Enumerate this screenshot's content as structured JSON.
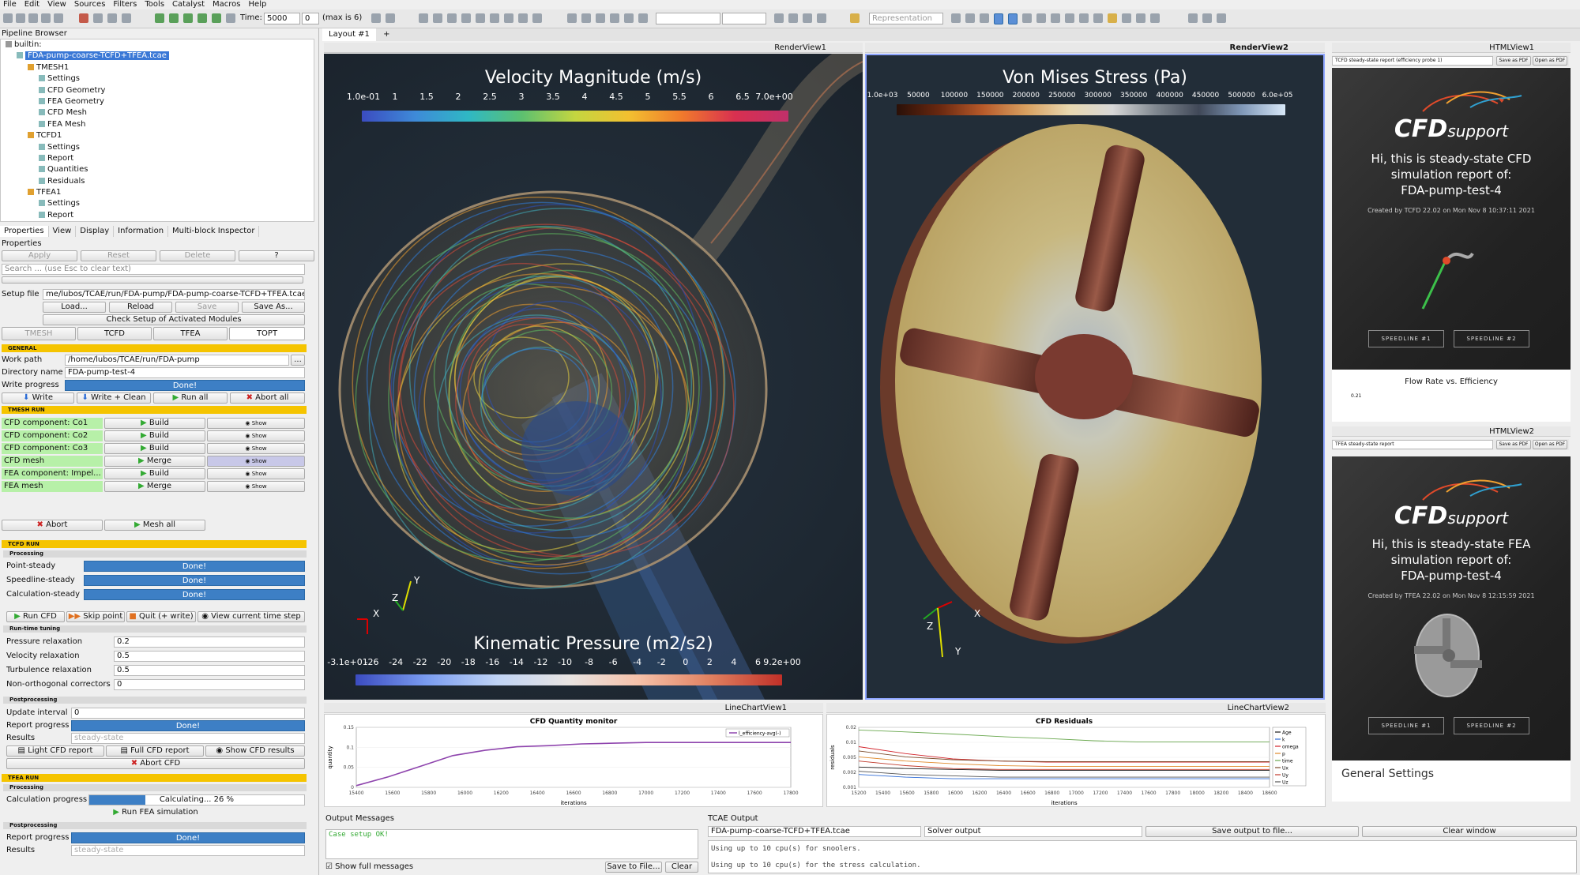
{
  "menu": [
    "File",
    "Edit",
    "View",
    "Sources",
    "Filters",
    "Tools",
    "Catalyst",
    "Macros",
    "Help"
  ],
  "toolbar": {
    "time_label": "Time:",
    "time_value": "5000",
    "step_value": "0",
    "max_label": "(max is 6)",
    "representation_placeholder": "Representation"
  },
  "pipeline": {
    "title": "Pipeline Browser",
    "items": [
      {
        "label": "builtin:",
        "depth": 0,
        "selected": false
      },
      {
        "label": "FDA-pump-coarse-TCFD+TFEA.tcae",
        "depth": 1,
        "selected": true
      },
      {
        "label": "TMESH1",
        "depth": 2,
        "selected": false
      },
      {
        "label": "Settings",
        "depth": 3,
        "selected": false
      },
      {
        "label": "CFD Geometry",
        "depth": 3,
        "selected": false
      },
      {
        "label": "FEA Geometry",
        "depth": 3,
        "selected": false
      },
      {
        "label": "CFD Mesh",
        "depth": 3,
        "selected": false
      },
      {
        "label": "FEA Mesh",
        "depth": 3,
        "selected": false
      },
      {
        "label": "TCFD1",
        "depth": 2,
        "selected": false
      },
      {
        "label": "Settings",
        "depth": 3,
        "selected": false
      },
      {
        "label": "Report",
        "depth": 3,
        "selected": false
      },
      {
        "label": "Quantities",
        "depth": 3,
        "selected": false
      },
      {
        "label": "Residuals",
        "depth": 3,
        "selected": false
      },
      {
        "label": "TFEA1",
        "depth": 2,
        "selected": false
      },
      {
        "label": "Settings",
        "depth": 3,
        "selected": false
      },
      {
        "label": "Report",
        "depth": 3,
        "selected": false
      }
    ]
  },
  "panel_tabs": [
    "Properties",
    "View",
    "Display",
    "Information",
    "Multi-block Inspector"
  ],
  "properties": {
    "title": "Properties",
    "apply": "Apply",
    "reset": "Reset",
    "delete": "Delete",
    "help": "?",
    "search_placeholder": "Search ... (use Esc to clear text)",
    "setup_file_label": "Setup file",
    "setup_file_value": "me/lubos/TCAE/run/FDA-pump/FDA-pump-coarse-TCFD+TFEA.tcae",
    "load": "Load...",
    "reload": "Reload",
    "save": "Save",
    "save_as": "Save As...",
    "check_setup": "Check Setup of Activated Modules",
    "module_tabs": [
      "TMESH",
      "TCFD",
      "TFEA",
      "TOPT"
    ],
    "general": "GENERAL",
    "work_path_label": "Work path",
    "work_path_value": "/home/lubos/TCAE/run/FDA-pump",
    "browse": "...",
    "dir_name_label": "Directory name",
    "dir_name_value": "FDA-pump-test-4",
    "write_progress_label": "Write progress",
    "write_progress_value": "Done!",
    "write": "Write",
    "write_clean": "Write + Clean",
    "run_all": "Run all",
    "abort_all": "Abort all",
    "tmesh_run": "TMESH RUN",
    "tmesh_rows": [
      {
        "label": "CFD component: Co1",
        "action": "Build",
        "show": "Show"
      },
      {
        "label": "CFD component: Co2",
        "action": "Build",
        "show": "Show"
      },
      {
        "label": "CFD component: Co3",
        "action": "Build",
        "show": "Show"
      },
      {
        "label": "CFD mesh",
        "action": "Merge",
        "show": "Show"
      },
      {
        "label": "FEA component: Impel...",
        "action": "Build",
        "show": "Show"
      },
      {
        "label": "FEA mesh",
        "action": "Merge",
        "show": "Show"
      }
    ],
    "abort": "Abort",
    "mesh_all": "Mesh all",
    "tcfd_run": "TCFD RUN",
    "processing": "Processing",
    "steps": [
      {
        "label": "Point-steady",
        "value": "Done!"
      },
      {
        "label": "Speedline-steady",
        "value": "Done!"
      },
      {
        "label": "Calculation-steady",
        "value": "Done!"
      }
    ],
    "run_cfd": "Run CFD",
    "skip_point": "Skip point",
    "quit_write": "Quit (+ write)",
    "view_step": "View current time step",
    "runtime_tuning": "Run-time tuning",
    "tuning": [
      {
        "label": "Pressure relaxation",
        "value": "0.2"
      },
      {
        "label": "Velocity relaxation",
        "value": "0.5"
      },
      {
        "label": "Turbulence relaxation",
        "value": "0.5"
      },
      {
        "label": "Non-orthogonal correctors",
        "value": "0"
      }
    ],
    "postprocessing": "Postprocessing",
    "update_interval_label": "Update interval",
    "update_interval_value": "0",
    "report_progress_label": "Report progress",
    "report_progress_value": "Done!",
    "results_label": "Results",
    "results_value": "steady-state",
    "light_report": "Light CFD report",
    "full_report": "Full CFD report",
    "show_results": "Show CFD results",
    "abort_cfd": "Abort CFD",
    "tfea_run": "TFEA RUN",
    "calc_progress_label": "Calculation progress",
    "calc_progress_text": "Calculating... 26 %",
    "calc_progress_fraction": 0.26,
    "run_fea": "Run FEA simulation",
    "report_progress2_value": "Done!",
    "results2_value": "steady-state"
  },
  "layout": {
    "tab": "Layout #1",
    "add": "+"
  },
  "renderview1": {
    "name": "RenderView1",
    "title": "Velocity  Magnitude (m/s)",
    "ticks": [
      "1.0e-01",
      "1",
      "1.5",
      "2",
      "2.5",
      "3",
      "3.5",
      "4",
      "4.5",
      "5",
      "5.5",
      "6",
      "6.5",
      "7.0e+00"
    ],
    "title2": "Kinematic Pressure (m2/s2)",
    "ticks2": [
      "-3.1e+01",
      "-26",
      "-24",
      "-22",
      "-20",
      "-18",
      "-16",
      "-14",
      "-12",
      "-10",
      "-8",
      "-6",
      "-4",
      "-2",
      "0",
      "2",
      "4",
      "6",
      "9.2e+00"
    ],
    "axes": [
      "X",
      "Y",
      "Z"
    ]
  },
  "renderview2": {
    "name": "RenderView2",
    "title": "Von Mises Stress (Pa)",
    "ticks": [
      "1.0e+03",
      "50000",
      "100000",
      "150000",
      "200000",
      "250000",
      "300000",
      "350000",
      "400000",
      "450000",
      "500000",
      "6.0e+05"
    ],
    "axes": [
      "X",
      "Y",
      "Z"
    ]
  },
  "htmlview1": {
    "name": "HTMLView1",
    "select": "TCFD steady-state report (efficiency probe 1)",
    "save": "Save as PDF",
    "open": "Open as PDF",
    "logo_main": "CFD",
    "logo_sub": "support",
    "line1": "Hi, this is steady-state CFD",
    "line2": "simulation report of:",
    "line3": "FDA-pump-test-4",
    "created": "Created by TCFD 22.02 on Mon Nov 8 10:37:11 2021",
    "btn1": "SPEEDLINE #1",
    "btn2": "SPEEDLINE #2",
    "section": "Flow Rate vs. Efficiency",
    "axis_val": "0.21"
  },
  "htmlview2": {
    "name": "HTMLView2",
    "select": "TFEA steady-state report",
    "save": "Save as PDF",
    "open": "Open as PDF",
    "logo_main": "CFD",
    "logo_sub": "support",
    "line1": "Hi, this is steady-state FEA",
    "line2": "simulation report of:",
    "line3": "FDA-pump-test-4",
    "created": "Created by TFEA 22.02 on Mon Nov 8 12:15:59 2021",
    "btn1": "SPEEDLINE #1",
    "btn2": "SPEEDLINE #2",
    "section": "General Settings"
  },
  "linechart1": {
    "name": "LineChartView1",
    "title": "CFD Quantity monitor",
    "ylabel": "quantity",
    "xlabel": "iterations",
    "legend": "l_efficiency-avg(-)",
    "yticks": [
      "0.15",
      "0.1",
      "0.05",
      "0"
    ],
    "xticks": [
      "15400",
      "15600",
      "15800",
      "16000",
      "16200",
      "16400",
      "16600",
      "16800",
      "17000",
      "17200",
      "17400",
      "17600",
      "17800"
    ]
  },
  "linechart2": {
    "name": "LineChartView2",
    "title": "CFD Residuals",
    "ylabel": "residuals",
    "xlabel": "iterations",
    "legend": [
      "Age",
      "k",
      "omega",
      "p",
      "time",
      "Ux",
      "Uy",
      "Uz"
    ],
    "yticks": [
      "0.02",
      "0.01",
      "0.005",
      "0.002",
      "0.001"
    ],
    "xticks": [
      "15200",
      "15400",
      "15600",
      "15800",
      "16000",
      "16200",
      "16400",
      "16600",
      "16800",
      "17000",
      "17200",
      "17400",
      "17600",
      "17800",
      "18000",
      "18200",
      "18400",
      "18600"
    ]
  },
  "chart_data": [
    {
      "type": "line",
      "title": "CFD Quantity monitor",
      "xlabel": "iterations",
      "ylabel": "quantity",
      "xlim": [
        15200,
        17900
      ],
      "ylim": [
        0,
        0.17
      ],
      "series": [
        {
          "name": "l_efficiency-avg(-)",
          "color": "#8e44ad",
          "x": [
            15200,
            15400,
            15600,
            15800,
            16000,
            16200,
            16400,
            16600,
            16800,
            17000,
            17200,
            17400,
            17600,
            17800,
            17900
          ],
          "y": [
            0.005,
            0.03,
            0.06,
            0.09,
            0.105,
            0.115,
            0.118,
            0.123,
            0.125,
            0.127,
            0.127,
            0.127,
            0.127,
            0.127,
            0.127
          ]
        }
      ]
    },
    {
      "type": "line",
      "title": "CFD Residuals",
      "xlabel": "iterations",
      "ylabel": "residuals",
      "xlim": [
        15200,
        18700
      ],
      "ylim": [
        0.0005,
        0.03
      ],
      "yscale": "log",
      "series": [
        {
          "name": "Age",
          "color": "#1a1a1a",
          "x": [
            15200,
            15600,
            16000,
            16400,
            16800,
            17200,
            17600,
            18000,
            18400,
            18700
          ],
          "y": [
            0.002,
            0.0018,
            0.0017,
            0.0016,
            0.0016,
            0.0016,
            0.0016,
            0.0016,
            0.0016,
            0.0016
          ]
        },
        {
          "name": "k",
          "color": "#2e6bd6",
          "x": [
            15200,
            15600,
            16000,
            16400,
            16800,
            17200,
            17600,
            18000,
            18400,
            18700
          ],
          "y": [
            0.0012,
            0.001,
            0.0009,
            0.0009,
            0.0009,
            0.0009,
            0.0009,
            0.0009,
            0.0009,
            0.0009
          ]
        },
        {
          "name": "omega",
          "color": "#d2232a",
          "x": [
            15200,
            15600,
            16000,
            16400,
            16800,
            17200,
            17600,
            18000,
            18400,
            18700
          ],
          "y": [
            0.008,
            0.005,
            0.0035,
            0.003,
            0.0028,
            0.0028,
            0.0028,
            0.0028,
            0.0028,
            0.0028
          ]
        },
        {
          "name": "p",
          "color": "#e08a2c",
          "x": [
            15200,
            15600,
            16000,
            16400,
            16800,
            17200,
            17600,
            18000,
            18400,
            18700
          ],
          "y": [
            0.004,
            0.003,
            0.0025,
            0.0022,
            0.0021,
            0.0021,
            0.0021,
            0.0021,
            0.0021,
            0.0021
          ]
        },
        {
          "name": "time",
          "color": "#6aa84f",
          "x": [
            15200,
            15600,
            16000,
            16400,
            16800,
            17200,
            17600,
            18000,
            18400,
            18700
          ],
          "y": [
            0.025,
            0.022,
            0.019,
            0.016,
            0.014,
            0.012,
            0.011,
            0.011,
            0.011,
            0.011
          ]
        },
        {
          "name": "Ux",
          "color": "#7b4a2a",
          "x": [
            15200,
            15600,
            16000,
            16400,
            16800,
            17200,
            17600,
            18000,
            18400,
            18700
          ],
          "y": [
            0.006,
            0.004,
            0.0033,
            0.003,
            0.0029,
            0.0029,
            0.0029,
            0.0029,
            0.0029,
            0.0029
          ]
        },
        {
          "name": "Uy",
          "color": "#c0392b",
          "x": [
            15200,
            15600,
            16000,
            16400,
            16800,
            17200,
            17600,
            18000,
            18400,
            18700
          ],
          "y": [
            0.003,
            0.0022,
            0.0018,
            0.0017,
            0.0017,
            0.0017,
            0.0017,
            0.0017,
            0.0017,
            0.0017
          ]
        },
        {
          "name": "Uz",
          "color": "#555555",
          "x": [
            15200,
            15600,
            16000,
            16400,
            16800,
            17200,
            17600,
            18000,
            18400,
            18700
          ],
          "y": [
            0.0015,
            0.0012,
            0.0011,
            0.001,
            0.001,
            0.001,
            0.001,
            0.001,
            0.001,
            0.001
          ]
        }
      ]
    }
  ],
  "output_messages": {
    "title": "Output Messages",
    "text": "Case setup OK!",
    "show_full": "Show full messages",
    "save": "Save to File...",
    "clear": "Clear"
  },
  "tcae_output": {
    "title": "TCAE Output",
    "file": "FDA-pump-coarse-TCFD+TFEA.tcae",
    "kind": "Solver output",
    "save": "Save output to file...",
    "clear": "Clear window",
    "lines": [
      "Using up to 10 cpu(s) for snoolers.",
      "Using up to 10 cpu(s) for the stress calculation."
    ]
  }
}
